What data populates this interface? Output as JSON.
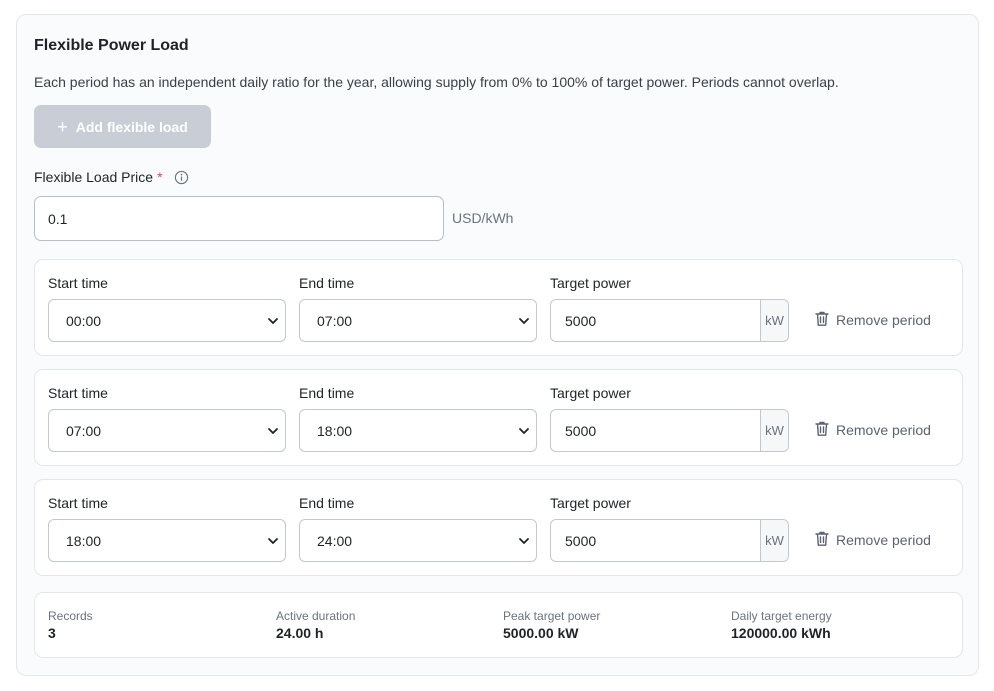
{
  "section": {
    "title": "Flexible Power Load",
    "description": "Each period has an independent daily ratio for the year, allowing supply from 0% to 100% of target power. Periods cannot overlap.",
    "add_button_label": "Add flexible load"
  },
  "price": {
    "label": "Flexible Load Price",
    "required_mark": "*",
    "value": "0.1",
    "unit": "USD/kWh"
  },
  "labels": {
    "start": "Start time",
    "end": "End time",
    "target": "Target power",
    "remove": "Remove period",
    "unit": "kW"
  },
  "periods": [
    {
      "start": "00:00",
      "end": "07:00",
      "target_power": "5000"
    },
    {
      "start": "07:00",
      "end": "18:00",
      "target_power": "5000"
    },
    {
      "start": "18:00",
      "end": "24:00",
      "target_power": "5000"
    }
  ],
  "summary": {
    "records_label": "Records",
    "records_value": "3",
    "duration_label": "Active duration",
    "duration_value": "24.00 h",
    "peak_label": "Peak target power",
    "peak_value": "5000.00 kW",
    "energy_label": "Daily target energy",
    "energy_value": "120000.00 kWh"
  },
  "colors": {
    "required": "#e5484d",
    "disabled_button": "#c9ced6"
  }
}
